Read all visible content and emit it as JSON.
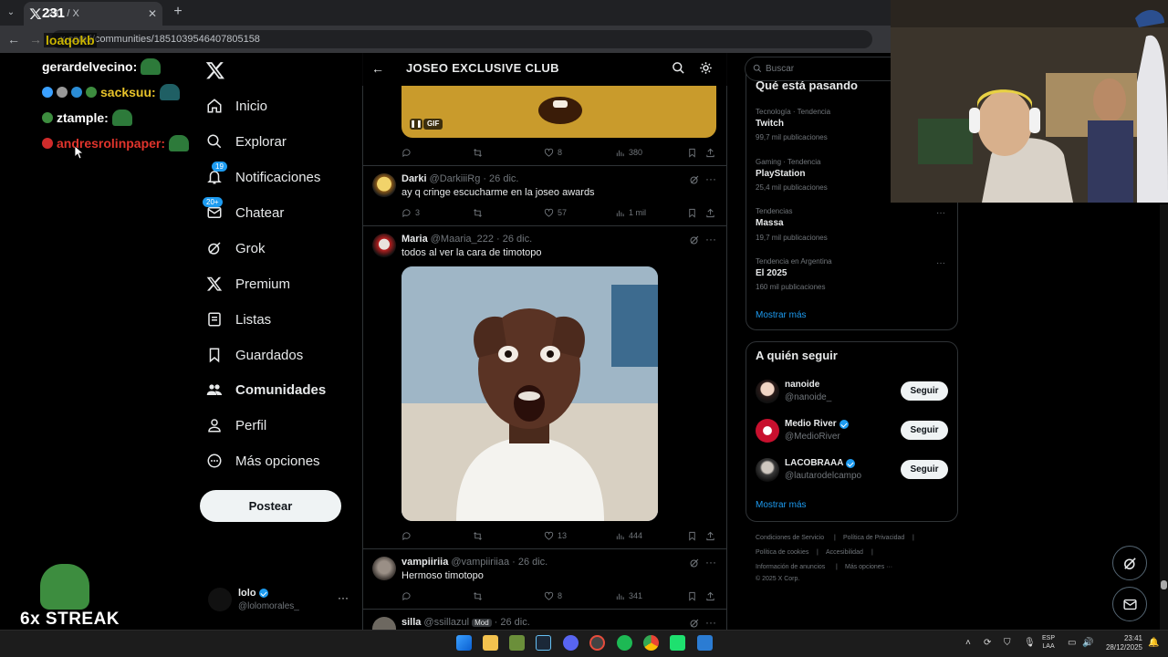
{
  "browser": {
    "tab_title": "231 / X",
    "url": "x.com/i/communities/1851039546407805158"
  },
  "overlay": {
    "top_name": "231",
    "top_name2": "loaqokb",
    "streak": "6x STREAK",
    "chat": [
      {
        "user": "gerardelvecino:",
        "color": "#ffffff"
      },
      {
        "user": "sacksuu:",
        "color": "#e8c32a"
      },
      {
        "user": "ztample:",
        "color": "#ffffff"
      },
      {
        "user": "andresrolinpaper:",
        "color": "#e0342c"
      }
    ]
  },
  "sidebar": {
    "items": [
      {
        "label": "Inicio",
        "icon": "home-icon"
      },
      {
        "label": "Explorar",
        "icon": "search-icon"
      },
      {
        "label": "Notificaciones",
        "icon": "bell-icon",
        "badge": "19"
      },
      {
        "label": "Chatear",
        "icon": "mail-icon",
        "badge": "20+"
      },
      {
        "label": "Grok",
        "icon": "grok-icon"
      },
      {
        "label": "Premium",
        "icon": "x-icon"
      },
      {
        "label": "Listas",
        "icon": "list-icon"
      },
      {
        "label": "Guardados",
        "icon": "bookmark-icon"
      },
      {
        "label": "Comunidades",
        "icon": "people-icon",
        "active": true
      },
      {
        "label": "Perfil",
        "icon": "person-icon"
      },
      {
        "label": "Más opciones",
        "icon": "more-circle-icon"
      }
    ],
    "post_label": "Postear",
    "account": {
      "name": "lolo",
      "handle": "@lolomorales_"
    }
  },
  "header": {
    "title": "JOSEO EXCLUSIVE CLUB"
  },
  "feed": {
    "gif_label": "GIF",
    "first_actions": {
      "replies": "",
      "reposts": "",
      "likes": "8",
      "views": "380"
    },
    "tweets": [
      {
        "name": "Darki",
        "handle": "@DarkiiiRg",
        "date": "· 26 dic.",
        "text": "ay q cringe escucharme en la joseo awards",
        "replies": "3",
        "reposts": "",
        "likes": "57",
        "views": "1 mil"
      },
      {
        "name": "Maria",
        "handle": "@Maaria_222",
        "date": "· 26 dic.",
        "text": "todos al ver la cara de timotopo",
        "replies": "",
        "reposts": "",
        "likes": "13",
        "views": "444"
      },
      {
        "name": "vampiiriia",
        "handle": "@vampiiriiaa",
        "date": "· 26 dic.",
        "text": "Hermoso timotopo",
        "replies": "",
        "reposts": "",
        "likes": "8",
        "views": "341"
      },
      {
        "name": "silla",
        "handle": "@ssillazul",
        "date": "· 26 dic.",
        "mod": "Mod",
        "text": ""
      }
    ]
  },
  "right": {
    "search_placeholder": "Buscar",
    "trends_title": "Qué está pasando",
    "trends": [
      {
        "context": "Tecnología · Tendencia",
        "name": "Twitch",
        "count": "99,7 mil publicaciones"
      },
      {
        "context": "Gaming · Tendencia",
        "name": "PlayStation",
        "count": "25,4 mil publicaciones"
      },
      {
        "context": "Tendencias",
        "name": "Massa",
        "count": "19,7 mil publicaciones"
      },
      {
        "context": "Tendencia en Argentina",
        "name": "El 2025",
        "count": "160 mil publicaciones"
      }
    ],
    "show_more": "Mostrar más",
    "follow_title": "A quién seguir",
    "follow": [
      {
        "name": "nanoide",
        "handle": "@nanoide_",
        "verified": false,
        "btn": "Seguir"
      },
      {
        "name": "Medio River",
        "handle": "@MedioRiver",
        "verified": true,
        "btn": "Seguir"
      },
      {
        "name": "LACOBRAAA",
        "handle": "@lautarodelcampo",
        "verified": true,
        "btn": "Seguir"
      }
    ],
    "footer": [
      "Condiciones de Servicio",
      "|",
      "Política de Privacidad",
      "|",
      "Política de cookies",
      "|",
      "Accesibilidad",
      "|",
      "Información de anuncios",
      "|",
      "Más opciones ···",
      "© 2025 X Corp."
    ]
  },
  "taskbar": {
    "lang_top": "ESP",
    "lang_bottom": "LAA",
    "time": "23:41",
    "date": "28/12/2025"
  },
  "colors": {
    "accent": "#1d9bf0",
    "background": "#000000",
    "border": "#2f3336"
  }
}
